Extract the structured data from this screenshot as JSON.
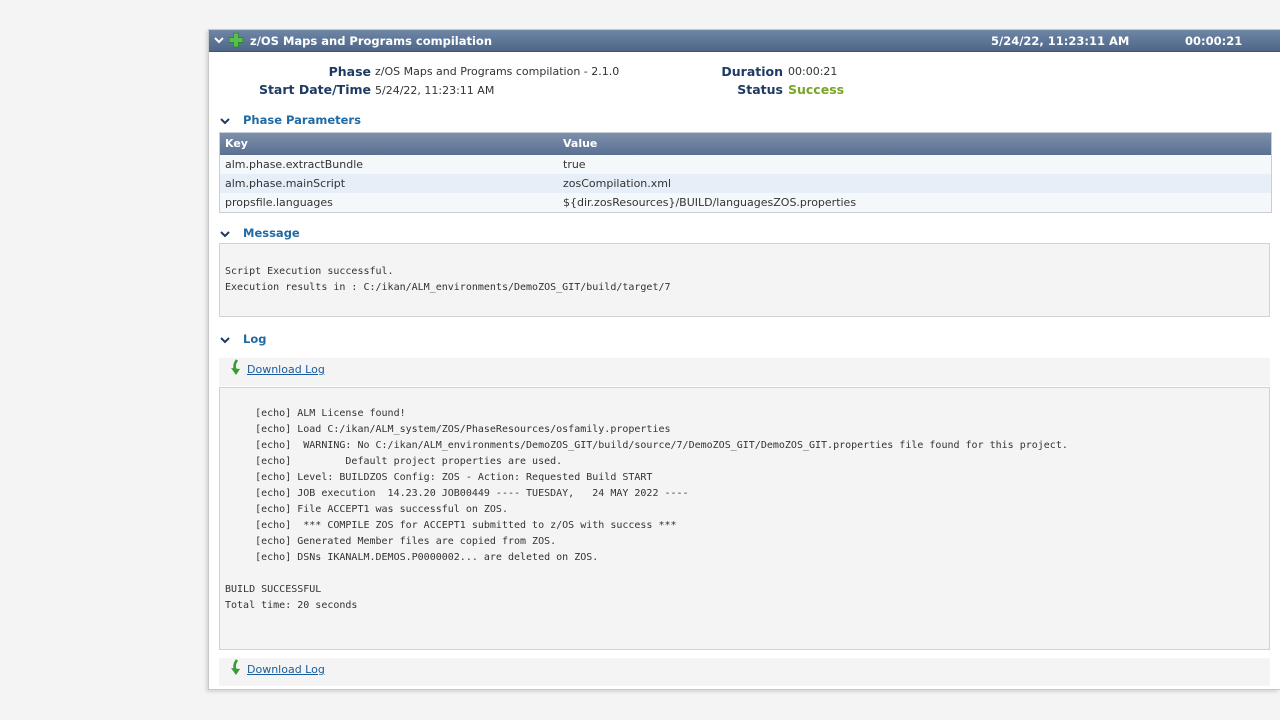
{
  "header": {
    "title": "z/OS Maps and Programs compilation",
    "date": "5/24/22, 11:23:11 AM",
    "duration": "00:00:21"
  },
  "info": {
    "phase_label": "Phase",
    "phase_value": "z/OS Maps and Programs compilation - 2.1.0",
    "start_label": "Start Date/Time",
    "start_value": "5/24/22, 11:23:11 AM",
    "duration_label": "Duration",
    "duration_value": "00:00:21",
    "status_label": "Status",
    "status_value": "Success"
  },
  "phase_parameters": {
    "title": "Phase Parameters",
    "columns": [
      "Key",
      "Value"
    ],
    "rows": [
      {
        "key": "alm.phase.extractBundle",
        "value": "true"
      },
      {
        "key": "alm.phase.mainScript",
        "value": "zosCompilation.xml"
      },
      {
        "key": "propsfile.languages",
        "value": "${dir.zosResources}/BUILD/languagesZOS.properties"
      }
    ]
  },
  "message": {
    "title": "Message",
    "lines": [
      "Script Execution successful.",
      "Execution results in : C:/ikan/ALM_environments/DemoZOS_GIT/build/target/7"
    ]
  },
  "log": {
    "title": "Log",
    "download_label": "Download Log",
    "lines": [
      "     [echo] ALM License found!",
      "     [echo] Load C:/ikan/ALM_system/ZOS/PhaseResources/osfamily.properties",
      "     [echo]  WARNING: No C:/ikan/ALM_environments/DemoZOS_GIT/build/source/7/DemoZOS_GIT/DemoZOS_GIT.properties file found for this project.",
      "     [echo]         Default project properties are used.",
      "     [echo] Level: BUILDZOS Config: ZOS - Action: Requested Build START",
      "     [echo] JOB execution  14.23.20 JOB00449 ---- TUESDAY,   24 MAY 2022 ----",
      "     [echo] File ACCEPT1 was successful on ZOS.",
      "     [echo]  *** COMPILE ZOS for ACCEPT1 submitted to z/OS with success ***",
      "     [echo] Generated Member files are copied from ZOS.",
      "     [echo] DSNs IKANALM.DEMOS.P0000002... are deleted on ZOS.",
      "",
      "BUILD SUCCESSFUL",
      "Total time: 20 seconds"
    ]
  },
  "colors": {
    "header_bar": "#5a7192",
    "section_title": "#1f6aa5",
    "label": "#1f3b63",
    "success": "#7aa428",
    "link": "#1a5c9e"
  },
  "icons": [
    "chevron-down-icon",
    "plus-icon",
    "download-arrow-icon"
  ]
}
